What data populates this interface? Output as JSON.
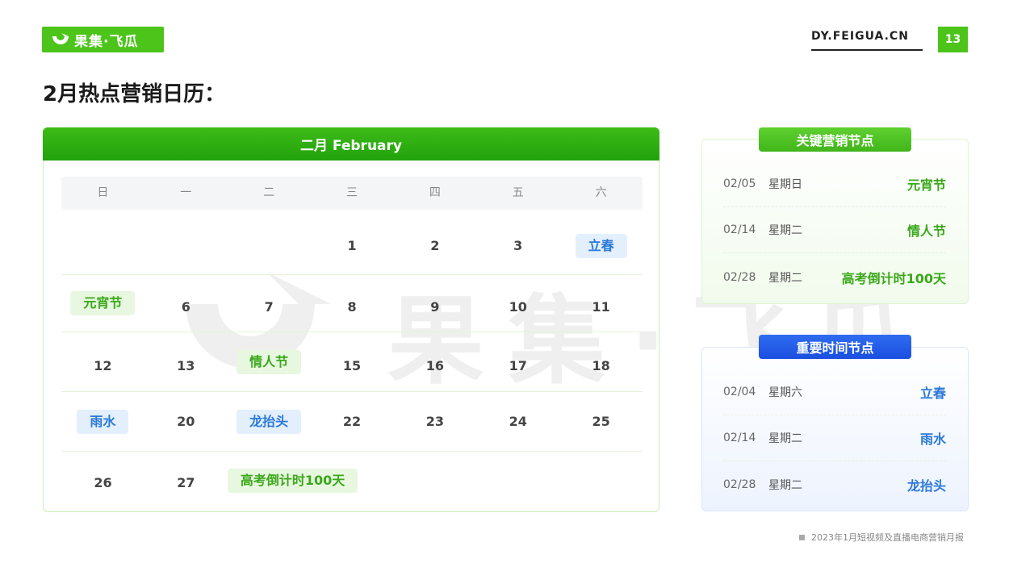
{
  "brand": {
    "logo_text": "果集·飞瓜",
    "site": "DY.FEIGUA.CN",
    "page_number": "13",
    "accent": "#4cc41a"
  },
  "title": "2月热点营销日历：",
  "calendar": {
    "month": "二月 February",
    "weekdays": [
      "日",
      "一",
      "二",
      "三",
      "四",
      "五",
      "六"
    ],
    "weeks": [
      [
        "",
        "",
        "",
        "1",
        "2",
        "3",
        "立春"
      ],
      [
        "元宵节",
        "6",
        "7",
        "8",
        "9",
        "10",
        "11"
      ],
      [
        "12",
        "13",
        "情人节",
        "15",
        "16",
        "17",
        "18"
      ],
      [
        "雨水",
        "20",
        "龙抬头",
        "22",
        "23",
        "24",
        "25"
      ],
      [
        "26",
        "27",
        "高考倒计时100天",
        "",
        "",
        "",
        ""
      ]
    ]
  },
  "key_nodes": {
    "label": "关键营销节点",
    "items": [
      {
        "date": "02/05",
        "weekday": "星期日",
        "name": "元宵节"
      },
      {
        "date": "02/14",
        "weekday": "星期二",
        "name": "情人节"
      },
      {
        "date": "02/28",
        "weekday": "星期二",
        "name": "高考倒计时100天"
      }
    ]
  },
  "important_nodes": {
    "label": "重要时间节点",
    "items": [
      {
        "date": "02/04",
        "weekday": "星期六",
        "name": "立春"
      },
      {
        "date": "02/14",
        "weekday": "星期二",
        "name": "雨水"
      },
      {
        "date": "02/28",
        "weekday": "星期二",
        "name": "龙抬头"
      }
    ]
  },
  "footer": "2023年1月短视频及直播电商营销月报",
  "watermark": "果集·飞瓜"
}
